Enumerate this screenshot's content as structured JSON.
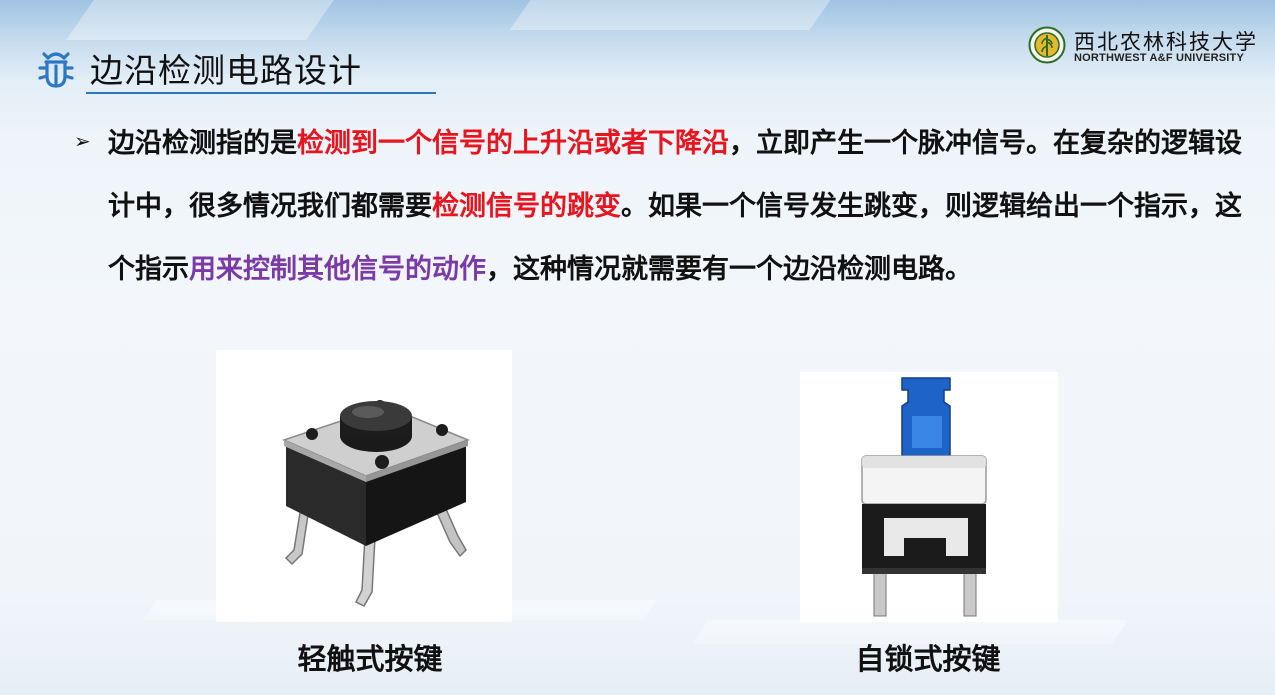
{
  "slide": {
    "title": "边沿检测电路设计",
    "logo": {
      "name_cn": "西北农林科技大学",
      "name_en": "NORTHWEST A&F UNIVERSITY"
    },
    "bullet": {
      "marker": "➢",
      "segments": [
        {
          "text": "边沿检测指的是",
          "style": "normal"
        },
        {
          "text": "检测到一个信号的上升沿或者下降沿",
          "style": "red"
        },
        {
          "text": "，立即产生一个脉冲信号。在复杂的逻辑设计中，很多情况我们都需要",
          "style": "normal"
        },
        {
          "text": "检测信号的跳变",
          "style": "red"
        },
        {
          "text": "。如果一个信号发生跳变，则逻辑给出一个指示，这个指示",
          "style": "normal"
        },
        {
          "text": "用来控制其他信号的动作",
          "style": "purple"
        },
        {
          "text": "，这种情况就需要有一个边沿检测电路。",
          "style": "normal"
        }
      ]
    },
    "images": [
      {
        "caption": "轻触式按键"
      },
      {
        "caption": "自锁式按键"
      }
    ],
    "colors": {
      "highlight_red": "#e8141e",
      "highlight_purple": "#7a3aa8",
      "accent_blue": "#2e78c2"
    }
  }
}
